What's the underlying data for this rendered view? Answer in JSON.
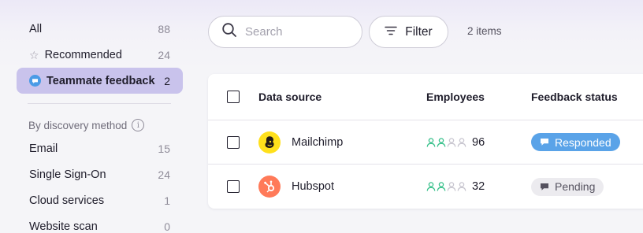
{
  "sidebar": {
    "items": [
      {
        "label": "All",
        "count": "88"
      },
      {
        "label": "Recommended",
        "count": "24",
        "icon": "star-icon"
      },
      {
        "label": "Teammate feedback",
        "count": "2",
        "icon": "chat-bubble-icon",
        "active": true
      }
    ],
    "section_title": "By discovery method",
    "methods": [
      {
        "label": "Email",
        "count": "15"
      },
      {
        "label": "Single Sign-On",
        "count": "24"
      },
      {
        "label": "Cloud services",
        "count": "1"
      },
      {
        "label": "Website scan",
        "count": "0"
      }
    ]
  },
  "toolbar": {
    "search_placeholder": "Search",
    "search_value": "",
    "filter_label": "Filter",
    "items_count": "2 items"
  },
  "table": {
    "columns": [
      "Data source",
      "Employees",
      "Feedback status"
    ],
    "rows": [
      {
        "source": "Mailchimp",
        "logo": "mailchimp-logo",
        "employees": "96",
        "employees_filled": 2,
        "employees_total": 4,
        "status": "Responded",
        "status_type": "responded"
      },
      {
        "source": "Hubspot",
        "logo": "hubspot-logo",
        "employees": "32",
        "employees_filled": 2,
        "employees_total": 4,
        "status": "Pending",
        "status_type": "pending"
      }
    ]
  },
  "colors": {
    "active_bg": "#c9c3ec",
    "accent_blue": "#5aa3e8",
    "people_green": "#36c08a",
    "mailchimp_yellow": "#ffe01b",
    "hubspot_orange": "#ff7a59"
  }
}
